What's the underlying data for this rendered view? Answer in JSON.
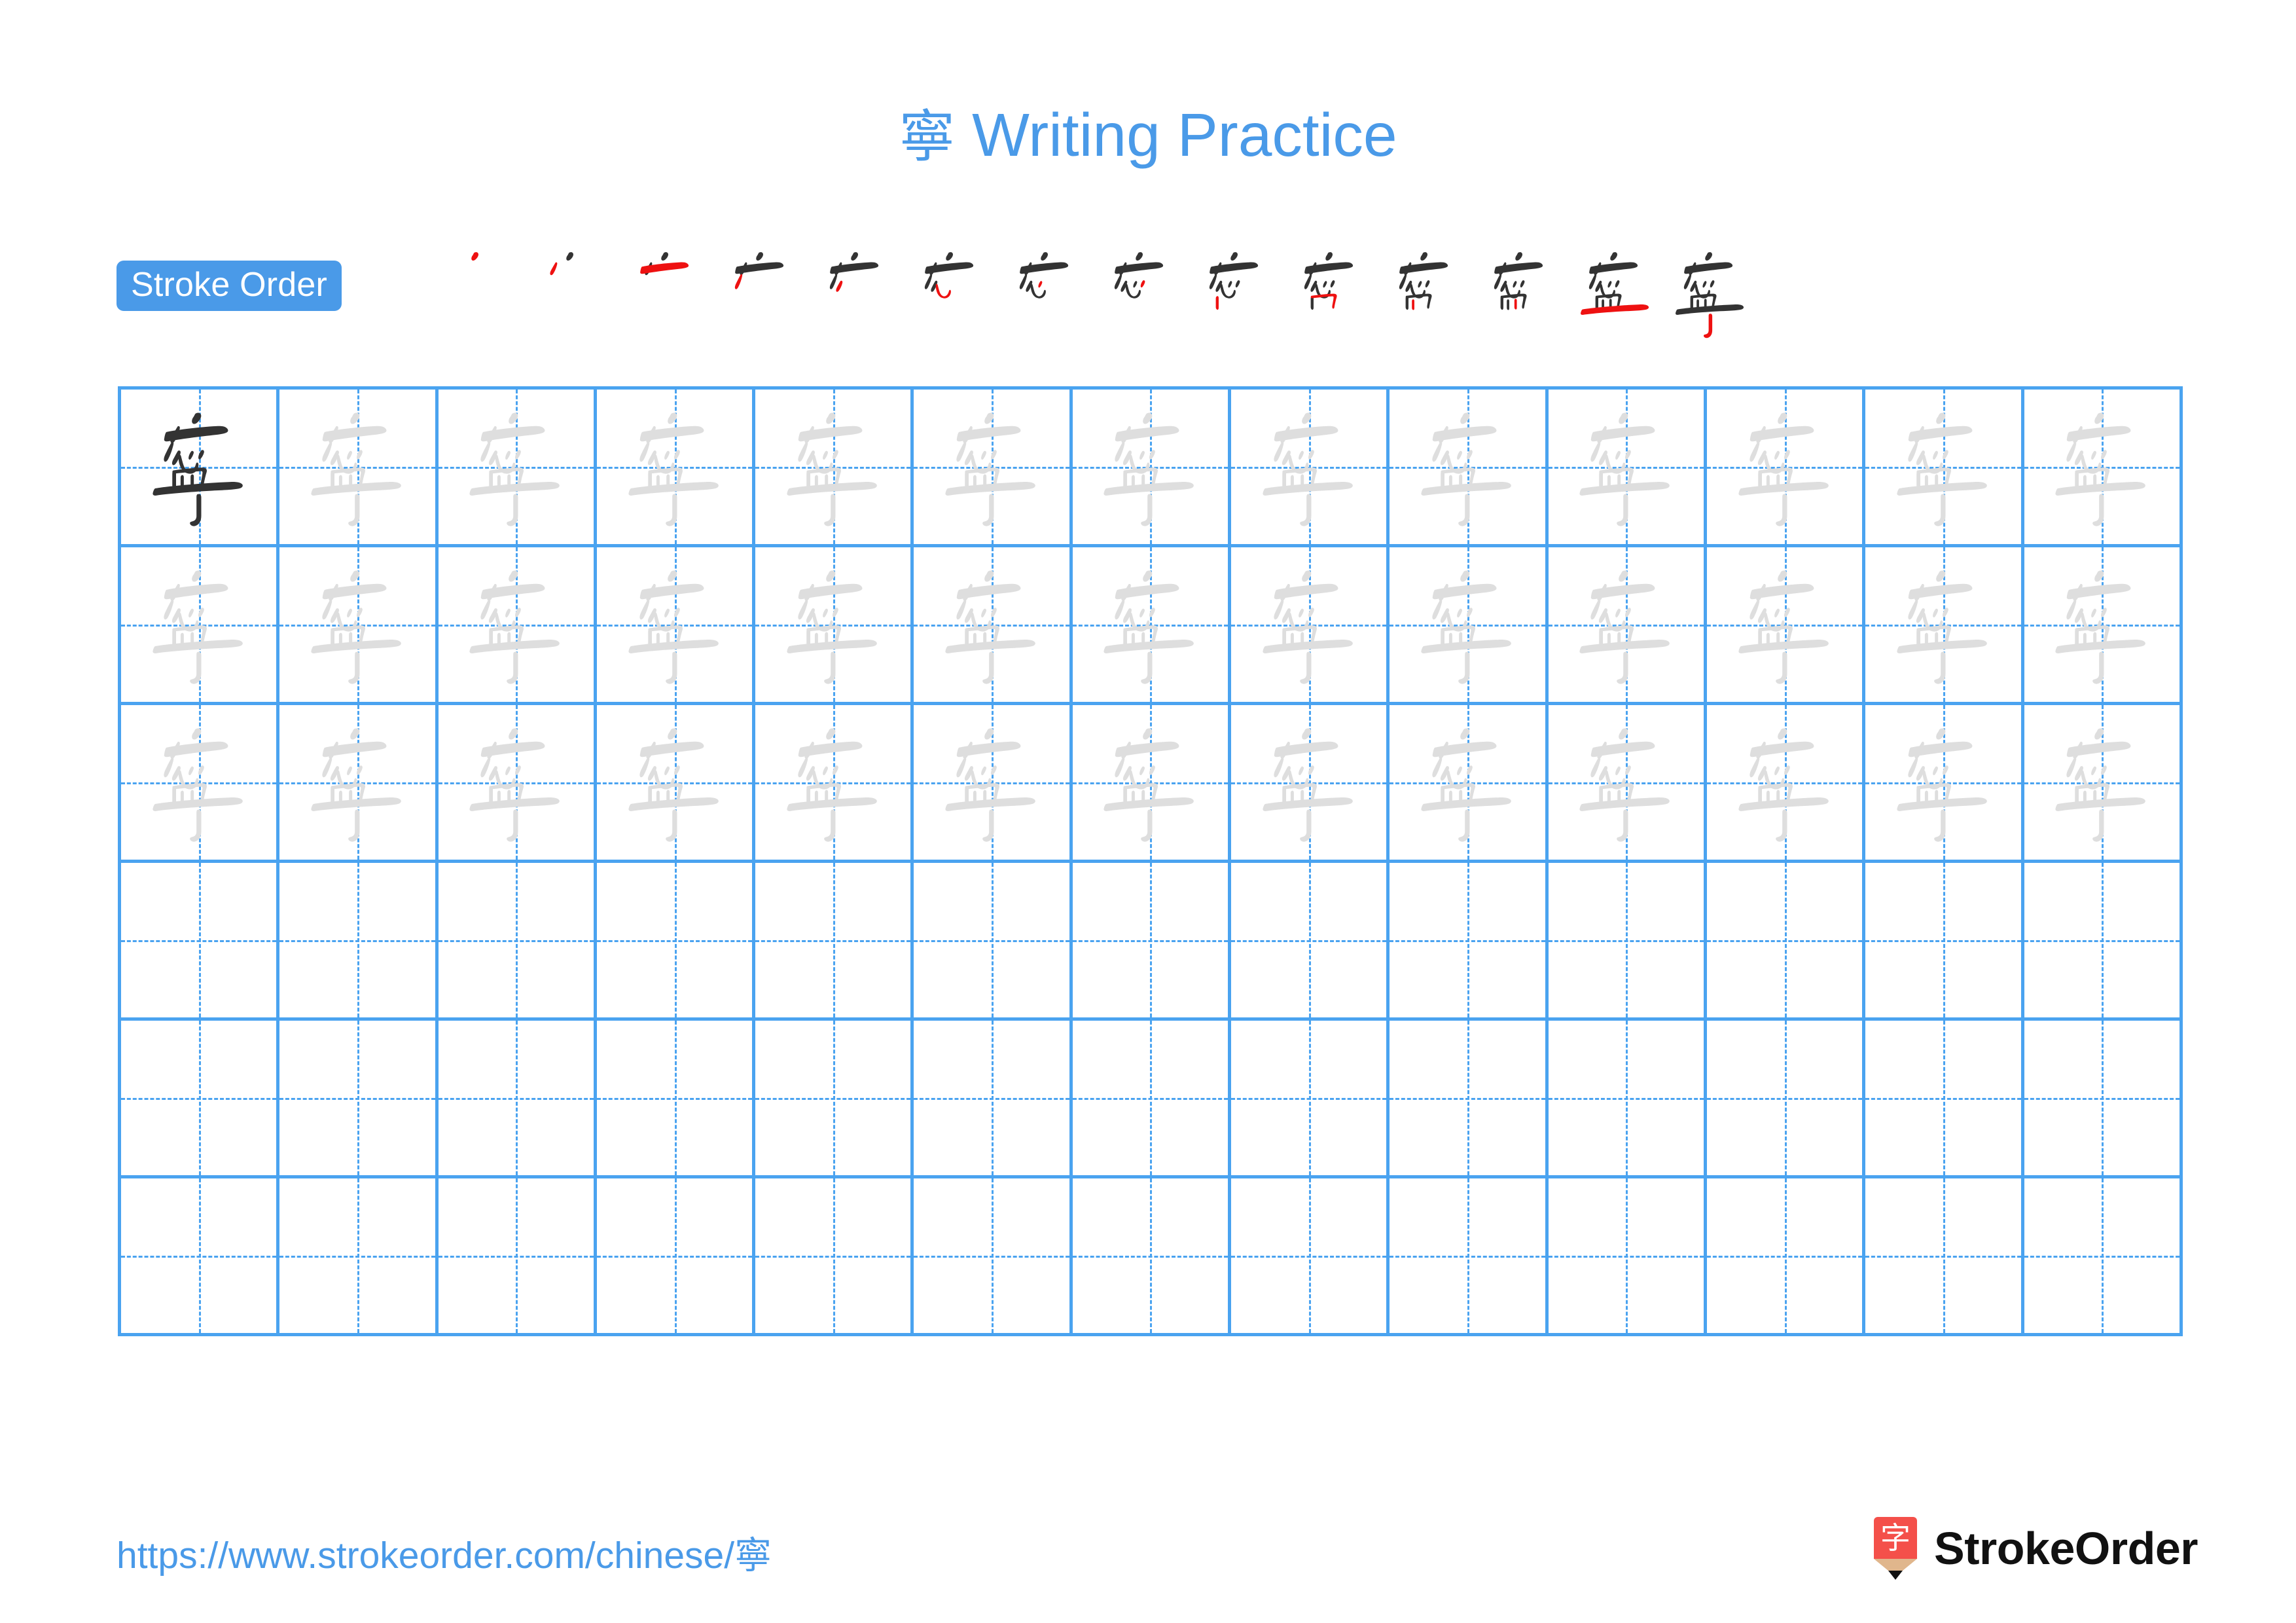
{
  "page": {
    "character": "寧",
    "title_suffix": " Writing Practice",
    "title_full": "寧 Writing Practice"
  },
  "stroke_order": {
    "badge_label": "Stroke Order",
    "total_strokes": 14,
    "new_stroke_color": "#ee1111",
    "done_stroke_color": "#333333",
    "steps": [
      {
        "index": 1,
        "name": "stroke-step-1"
      },
      {
        "index": 2,
        "name": "stroke-step-2"
      },
      {
        "index": 3,
        "name": "stroke-step-3"
      },
      {
        "index": 4,
        "name": "stroke-step-4"
      },
      {
        "index": 5,
        "name": "stroke-step-5"
      },
      {
        "index": 6,
        "name": "stroke-step-6"
      },
      {
        "index": 7,
        "name": "stroke-step-7"
      },
      {
        "index": 8,
        "name": "stroke-step-8"
      },
      {
        "index": 9,
        "name": "stroke-step-9"
      },
      {
        "index": 10,
        "name": "stroke-step-10"
      },
      {
        "index": 11,
        "name": "stroke-step-11"
      },
      {
        "index": 12,
        "name": "stroke-step-12"
      },
      {
        "index": 13,
        "name": "stroke-step-13"
      },
      {
        "index": 14,
        "name": "stroke-step-14"
      }
    ]
  },
  "grid": {
    "columns": 13,
    "rows": 6,
    "line_color": "#4aa3f0",
    "guide_color": "#4aa3f0",
    "model_char_color": "#333333",
    "trace_char_color": "#dedede",
    "cells": [
      [
        "model",
        "trace",
        "trace",
        "trace",
        "trace",
        "trace",
        "trace",
        "trace",
        "trace",
        "trace",
        "trace",
        "trace",
        "trace"
      ],
      [
        "trace",
        "trace",
        "trace",
        "trace",
        "trace",
        "trace",
        "trace",
        "trace",
        "trace",
        "trace",
        "trace",
        "trace",
        "trace"
      ],
      [
        "trace",
        "trace",
        "trace",
        "trace",
        "trace",
        "trace",
        "trace",
        "trace",
        "trace",
        "trace",
        "trace",
        "trace",
        "trace"
      ],
      [
        "empty",
        "empty",
        "empty",
        "empty",
        "empty",
        "empty",
        "empty",
        "empty",
        "empty",
        "empty",
        "empty",
        "empty",
        "empty"
      ],
      [
        "empty",
        "empty",
        "empty",
        "empty",
        "empty",
        "empty",
        "empty",
        "empty",
        "empty",
        "empty",
        "empty",
        "empty",
        "empty"
      ],
      [
        "empty",
        "empty",
        "empty",
        "empty",
        "empty",
        "empty",
        "empty",
        "empty",
        "empty",
        "empty",
        "empty",
        "empty",
        "empty"
      ]
    ]
  },
  "footer": {
    "url_prefix": "https://www.strokeorder.com/chinese/",
    "url_char": "寧",
    "url_full": "https://www.strokeorder.com/chinese/寧",
    "brand_name": "StrokeOrder",
    "brand_mark_char": "字",
    "brand_mark_color": "#f4504a",
    "brand_mark_wood_color": "#e0b68c"
  },
  "colors": {
    "title_blue": "#4a9ae8",
    "badge_blue": "#4a9ae8",
    "grid_blue": "#4aa3f0",
    "trace_gray": "#dedede",
    "ink_black": "#333333",
    "stroke_red": "#ee1111"
  }
}
